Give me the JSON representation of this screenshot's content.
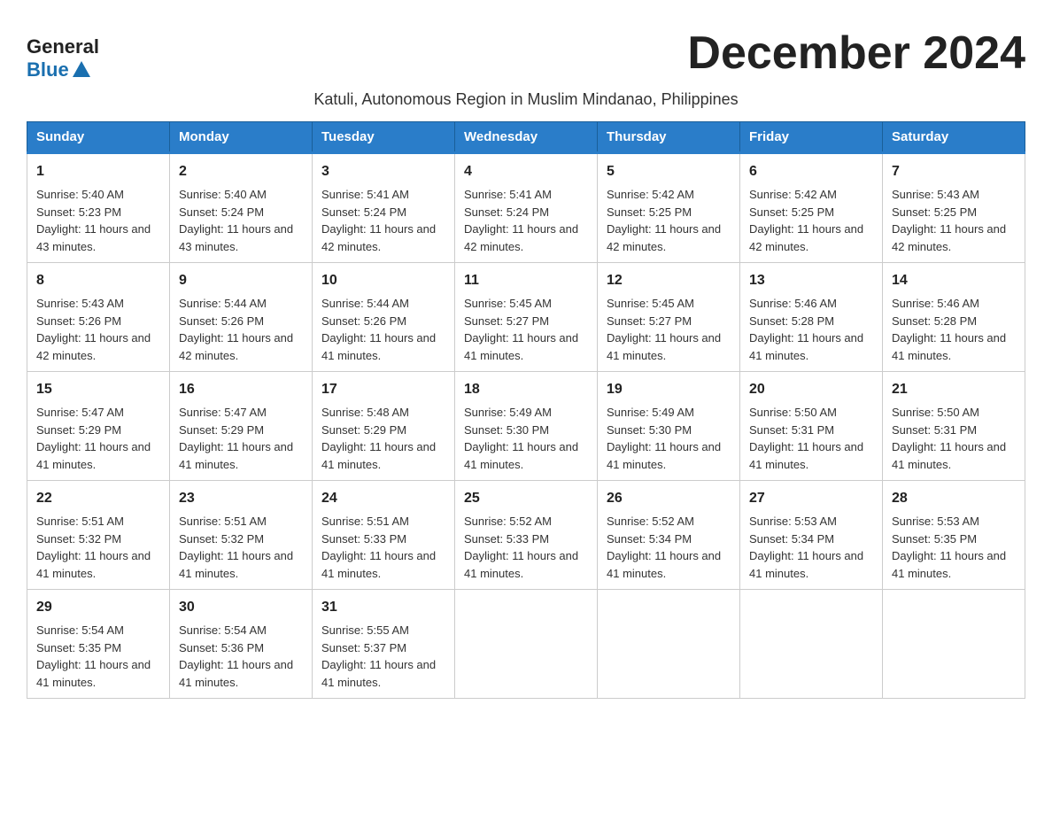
{
  "header": {
    "logo_general": "General",
    "logo_blue": "Blue",
    "month_title": "December 2024",
    "subtitle": "Katuli, Autonomous Region in Muslim Mindanao, Philippines"
  },
  "weekdays": [
    "Sunday",
    "Monday",
    "Tuesday",
    "Wednesday",
    "Thursday",
    "Friday",
    "Saturday"
  ],
  "weeks": [
    [
      {
        "day": "1",
        "sunrise": "Sunrise: 5:40 AM",
        "sunset": "Sunset: 5:23 PM",
        "daylight": "Daylight: 11 hours and 43 minutes."
      },
      {
        "day": "2",
        "sunrise": "Sunrise: 5:40 AM",
        "sunset": "Sunset: 5:24 PM",
        "daylight": "Daylight: 11 hours and 43 minutes."
      },
      {
        "day": "3",
        "sunrise": "Sunrise: 5:41 AM",
        "sunset": "Sunset: 5:24 PM",
        "daylight": "Daylight: 11 hours and 42 minutes."
      },
      {
        "day": "4",
        "sunrise": "Sunrise: 5:41 AM",
        "sunset": "Sunset: 5:24 PM",
        "daylight": "Daylight: 11 hours and 42 minutes."
      },
      {
        "day": "5",
        "sunrise": "Sunrise: 5:42 AM",
        "sunset": "Sunset: 5:25 PM",
        "daylight": "Daylight: 11 hours and 42 minutes."
      },
      {
        "day": "6",
        "sunrise": "Sunrise: 5:42 AM",
        "sunset": "Sunset: 5:25 PM",
        "daylight": "Daylight: 11 hours and 42 minutes."
      },
      {
        "day": "7",
        "sunrise": "Sunrise: 5:43 AM",
        "sunset": "Sunset: 5:25 PM",
        "daylight": "Daylight: 11 hours and 42 minutes."
      }
    ],
    [
      {
        "day": "8",
        "sunrise": "Sunrise: 5:43 AM",
        "sunset": "Sunset: 5:26 PM",
        "daylight": "Daylight: 11 hours and 42 minutes."
      },
      {
        "day": "9",
        "sunrise": "Sunrise: 5:44 AM",
        "sunset": "Sunset: 5:26 PM",
        "daylight": "Daylight: 11 hours and 42 minutes."
      },
      {
        "day": "10",
        "sunrise": "Sunrise: 5:44 AM",
        "sunset": "Sunset: 5:26 PM",
        "daylight": "Daylight: 11 hours and 41 minutes."
      },
      {
        "day": "11",
        "sunrise": "Sunrise: 5:45 AM",
        "sunset": "Sunset: 5:27 PM",
        "daylight": "Daylight: 11 hours and 41 minutes."
      },
      {
        "day": "12",
        "sunrise": "Sunrise: 5:45 AM",
        "sunset": "Sunset: 5:27 PM",
        "daylight": "Daylight: 11 hours and 41 minutes."
      },
      {
        "day": "13",
        "sunrise": "Sunrise: 5:46 AM",
        "sunset": "Sunset: 5:28 PM",
        "daylight": "Daylight: 11 hours and 41 minutes."
      },
      {
        "day": "14",
        "sunrise": "Sunrise: 5:46 AM",
        "sunset": "Sunset: 5:28 PM",
        "daylight": "Daylight: 11 hours and 41 minutes."
      }
    ],
    [
      {
        "day": "15",
        "sunrise": "Sunrise: 5:47 AM",
        "sunset": "Sunset: 5:29 PM",
        "daylight": "Daylight: 11 hours and 41 minutes."
      },
      {
        "day": "16",
        "sunrise": "Sunrise: 5:47 AM",
        "sunset": "Sunset: 5:29 PM",
        "daylight": "Daylight: 11 hours and 41 minutes."
      },
      {
        "day": "17",
        "sunrise": "Sunrise: 5:48 AM",
        "sunset": "Sunset: 5:29 PM",
        "daylight": "Daylight: 11 hours and 41 minutes."
      },
      {
        "day": "18",
        "sunrise": "Sunrise: 5:49 AM",
        "sunset": "Sunset: 5:30 PM",
        "daylight": "Daylight: 11 hours and 41 minutes."
      },
      {
        "day": "19",
        "sunrise": "Sunrise: 5:49 AM",
        "sunset": "Sunset: 5:30 PM",
        "daylight": "Daylight: 11 hours and 41 minutes."
      },
      {
        "day": "20",
        "sunrise": "Sunrise: 5:50 AM",
        "sunset": "Sunset: 5:31 PM",
        "daylight": "Daylight: 11 hours and 41 minutes."
      },
      {
        "day": "21",
        "sunrise": "Sunrise: 5:50 AM",
        "sunset": "Sunset: 5:31 PM",
        "daylight": "Daylight: 11 hours and 41 minutes."
      }
    ],
    [
      {
        "day": "22",
        "sunrise": "Sunrise: 5:51 AM",
        "sunset": "Sunset: 5:32 PM",
        "daylight": "Daylight: 11 hours and 41 minutes."
      },
      {
        "day": "23",
        "sunrise": "Sunrise: 5:51 AM",
        "sunset": "Sunset: 5:32 PM",
        "daylight": "Daylight: 11 hours and 41 minutes."
      },
      {
        "day": "24",
        "sunrise": "Sunrise: 5:51 AM",
        "sunset": "Sunset: 5:33 PM",
        "daylight": "Daylight: 11 hours and 41 minutes."
      },
      {
        "day": "25",
        "sunrise": "Sunrise: 5:52 AM",
        "sunset": "Sunset: 5:33 PM",
        "daylight": "Daylight: 11 hours and 41 minutes."
      },
      {
        "day": "26",
        "sunrise": "Sunrise: 5:52 AM",
        "sunset": "Sunset: 5:34 PM",
        "daylight": "Daylight: 11 hours and 41 minutes."
      },
      {
        "day": "27",
        "sunrise": "Sunrise: 5:53 AM",
        "sunset": "Sunset: 5:34 PM",
        "daylight": "Daylight: 11 hours and 41 minutes."
      },
      {
        "day": "28",
        "sunrise": "Sunrise: 5:53 AM",
        "sunset": "Sunset: 5:35 PM",
        "daylight": "Daylight: 11 hours and 41 minutes."
      }
    ],
    [
      {
        "day": "29",
        "sunrise": "Sunrise: 5:54 AM",
        "sunset": "Sunset: 5:35 PM",
        "daylight": "Daylight: 11 hours and 41 minutes."
      },
      {
        "day": "30",
        "sunrise": "Sunrise: 5:54 AM",
        "sunset": "Sunset: 5:36 PM",
        "daylight": "Daylight: 11 hours and 41 minutes."
      },
      {
        "day": "31",
        "sunrise": "Sunrise: 5:55 AM",
        "sunset": "Sunset: 5:37 PM",
        "daylight": "Daylight: 11 hours and 41 minutes."
      },
      null,
      null,
      null,
      null
    ]
  ]
}
